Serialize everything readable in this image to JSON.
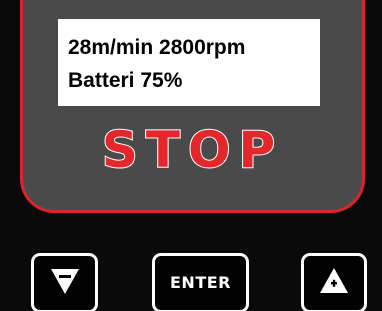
{
  "display": {
    "line1": "28m/min 2800rpm",
    "line2": "Batteri 75%",
    "status": "STOP"
  },
  "keys": {
    "down_icon": "down-triangle-minus-icon",
    "enter_label": "ENTER",
    "up_icon": "up-triangle-plus-icon"
  },
  "colors": {
    "accent_red": "#e5262b",
    "body": "#0a0a0a",
    "screen_bezel": "#4a4a4a",
    "lcd": "#ffffff"
  }
}
